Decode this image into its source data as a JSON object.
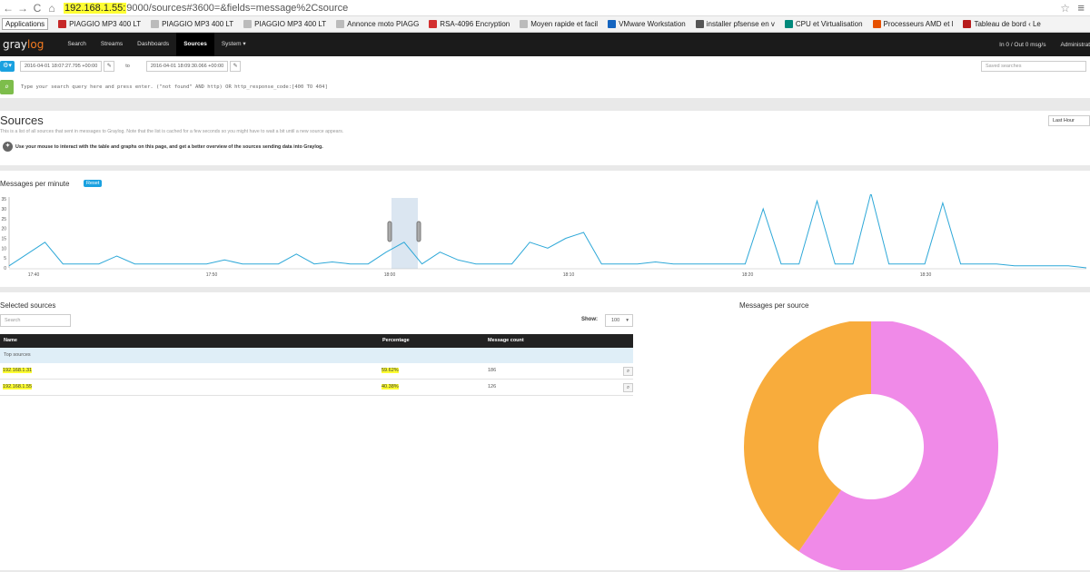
{
  "browser": {
    "url_highlight": "192.168.1.55:",
    "url_rest": "9000/sources#3600=&fields=message%2Csource",
    "back": "←",
    "forward": "→",
    "reload": "C",
    "home": "⌂",
    "star": "☆",
    "menu": "≡"
  },
  "bookmarks": [
    {
      "label": "Applications",
      "color": ""
    },
    {
      "label": "PIAGGIO MP3 400 LT",
      "color": "#c62828"
    },
    {
      "label": "PIAGGIO MP3 400 LT",
      "color": "#bbbbbb"
    },
    {
      "label": "PIAGGIO MP3 400 LT",
      "color": "#bbbbbb"
    },
    {
      "label": "Annonce moto PIAGG",
      "color": "#bbbbbb"
    },
    {
      "label": "RSA-4096 Encryption",
      "color": "#d32f2f"
    },
    {
      "label": "Moyen rapide et facil",
      "color": "#bbbbbb"
    },
    {
      "label": "VMware Workstation",
      "color": "#1565c0"
    },
    {
      "label": "installer pfsense en v",
      "color": "#555555"
    },
    {
      "label": "CPU et Virtualisation",
      "color": "#00897b"
    },
    {
      "label": "Processeurs AMD et l",
      "color": "#e65100"
    },
    {
      "label": "Tableau de bord ‹ Le",
      "color": "#b71c1c"
    }
  ],
  "nav": {
    "logo_a": "gray",
    "logo_b": "log",
    "items": [
      "Search",
      "Streams",
      "Dashboards",
      "Sources",
      "System ▾"
    ],
    "active": "Sources",
    "throughput": "In 0 / Out 0 msg/s",
    "user": "Administrat"
  },
  "search": {
    "from": "2016-04-01 18:07:27.795 +00:00",
    "to_label": "to",
    "to": "2016-04-01 18:09:30.066 +00:00",
    "saved_placeholder": "Saved searches",
    "query_placeholder": "Type your search query here and press enter. (\"not found\" AND http) OR http_response_code:[400 TO 404]"
  },
  "sources_page": {
    "title": "Sources",
    "description": "This is a list of all sources that sent in messages to Graylog. Note that the list is cached for a few seconds so you might have to wait a bit until a new source appears.",
    "tip": "Use your mouse to interact with the table and graphs on this page, and get a better overview of the sources sending data into Graylog.",
    "range": "Last Hour"
  },
  "chart_panel": {
    "title": "Messages per minute",
    "reset_label": "Reset"
  },
  "chart_data": {
    "type": "line",
    "title": "Messages per minute",
    "ylim": [
      0,
      36
    ],
    "yticks": [
      0,
      5,
      10,
      15,
      20,
      25,
      30,
      35
    ],
    "xtick_labels": [
      "17:40",
      "17:50",
      "18:00",
      "18:10",
      "18:20",
      "18:30"
    ],
    "series": [
      {
        "values": [
          1,
          7,
          13,
          2,
          2,
          2,
          6,
          2,
          2,
          2,
          2,
          2,
          4,
          2,
          2,
          2,
          7,
          2,
          3,
          2,
          2,
          8,
          13,
          2,
          8,
          4,
          2,
          2,
          2,
          13,
          10,
          15,
          18,
          2,
          2,
          2,
          3,
          2,
          2,
          2,
          2,
          2,
          30,
          2,
          2,
          34,
          2,
          2,
          38,
          2,
          2,
          2,
          33,
          2,
          2,
          2,
          1,
          1,
          1,
          1,
          0
        ]
      }
    ]
  },
  "selected_sources": {
    "title": "Selected sources",
    "search_placeholder": "Search",
    "show_label": "Show:",
    "show_value": "100",
    "columns": [
      "Name",
      "Percentage",
      "Message count"
    ],
    "group_label": "Top sources",
    "rows": [
      {
        "name": "192.168.1.31",
        "percentage": "59.62%",
        "count": "186"
      },
      {
        "name": "192.168.1.55",
        "percentage": "40.38%",
        "count": "126"
      }
    ]
  },
  "messages_per_source": {
    "title": "Messages per source",
    "slices": [
      {
        "label": "192.168.1.31",
        "value": 59.62,
        "color": "#f08ae8"
      },
      {
        "label": "192.168.1.55",
        "value": 40.38,
        "color": "#f8ac3c"
      }
    ]
  }
}
